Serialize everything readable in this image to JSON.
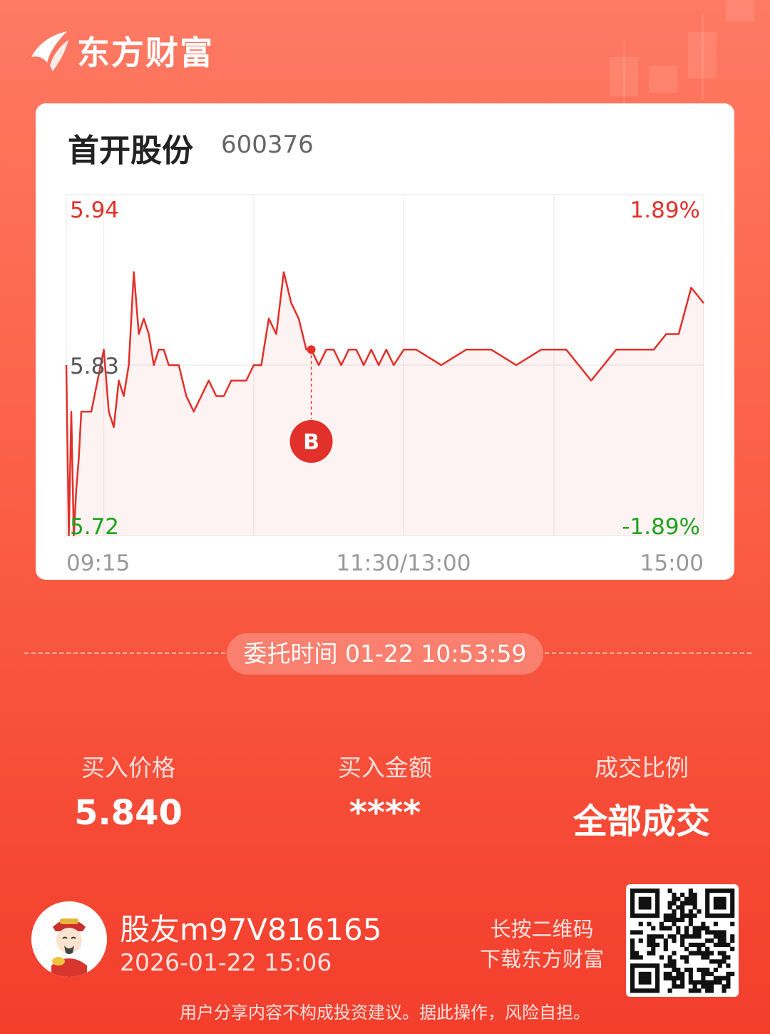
{
  "brand": {
    "name": "东方财富",
    "icon": "brand-logo-icon"
  },
  "stock": {
    "name": "首开股份",
    "code": "600376"
  },
  "colors": {
    "up": "#E2302A",
    "down": "#1DA31D",
    "grid": "#EEEEEE",
    "axis_text": "#999999"
  },
  "chart_data": {
    "type": "line",
    "ylim": [
      5.72,
      5.94
    ],
    "y_ticks_left": [
      "5.94",
      "5.83",
      "5.72"
    ],
    "y_ticks_right": [
      "1.89%",
      "",
      "-1.89%"
    ],
    "x_ticks": [
      "09:15",
      "11:30/13:00",
      "15:00"
    ],
    "x_range": [
      "09:15",
      "15:00"
    ],
    "grid": true,
    "series": [
      {
        "x": [
          "09:15",
          "09:16",
          "09:17",
          "09:18",
          "09:19",
          "09:20",
          "09:21",
          "09:22",
          "09:23",
          "09:24",
          "09:25",
          "09:30",
          "09:32",
          "09:34",
          "09:36",
          "09:38",
          "09:40",
          "09:42",
          "09:44",
          "09:46",
          "09:48",
          "09:50",
          "09:52",
          "09:54",
          "09:56",
          "09:58",
          "10:00",
          "10:03",
          "10:06",
          "10:09",
          "10:12",
          "10:15",
          "10:18",
          "10:21",
          "10:24",
          "10:27",
          "10:30",
          "10:33",
          "10:36",
          "10:39",
          "10:42",
          "10:45",
          "10:48",
          "10:51",
          "10:53",
          "10:56",
          "10:59",
          "11:02",
          "11:05",
          "11:08",
          "11:11",
          "11:14",
          "11:17",
          "11:20",
          "11:23",
          "11:26",
          "11:30",
          "13:05",
          "13:15",
          "13:25",
          "13:35",
          "13:45",
          "13:55",
          "14:05",
          "14:15",
          "14:25",
          "14:30",
          "14:35",
          "14:40",
          "14:45",
          "14:50",
          "14:55",
          "15:00"
        ],
        "y": [
          5.83,
          5.72,
          5.8,
          5.72,
          5.75,
          5.77,
          5.8,
          5.8,
          5.8,
          5.8,
          5.8,
          5.84,
          5.8,
          5.79,
          5.82,
          5.81,
          5.83,
          5.89,
          5.85,
          5.86,
          5.85,
          5.83,
          5.84,
          5.84,
          5.83,
          5.83,
          5.83,
          5.81,
          5.8,
          5.81,
          5.82,
          5.81,
          5.81,
          5.82,
          5.82,
          5.82,
          5.83,
          5.83,
          5.86,
          5.85,
          5.89,
          5.87,
          5.86,
          5.84,
          5.84,
          5.83,
          5.84,
          5.84,
          5.83,
          5.84,
          5.84,
          5.83,
          5.84,
          5.83,
          5.84,
          5.83,
          5.84,
          5.84,
          5.83,
          5.84,
          5.84,
          5.83,
          5.84,
          5.84,
          5.82,
          5.84,
          5.84,
          5.84,
          5.84,
          5.85,
          5.85,
          5.88,
          5.87
        ]
      }
    ],
    "marker": {
      "label": "B",
      "x": "10:53",
      "y": 5.84
    }
  },
  "order": {
    "time_label": "委托时间 01-22 10:53:59"
  },
  "stats": [
    {
      "label": "买入价格",
      "value": "5.840"
    },
    {
      "label": "买入金额",
      "value": "****"
    },
    {
      "label": "成交比例",
      "value": "全部成交"
    }
  ],
  "user": {
    "name": "股友m97V816165",
    "time": "2026-01-22 15:06",
    "avatar": "caishen-avatar-icon"
  },
  "qr": {
    "tip_line1": "长按二维码",
    "tip_line2": "下载东方财富",
    "icon": "qr-code-icon"
  },
  "disclaimer": "用户分享内容不构成投资建议。据此操作，风险自担。"
}
